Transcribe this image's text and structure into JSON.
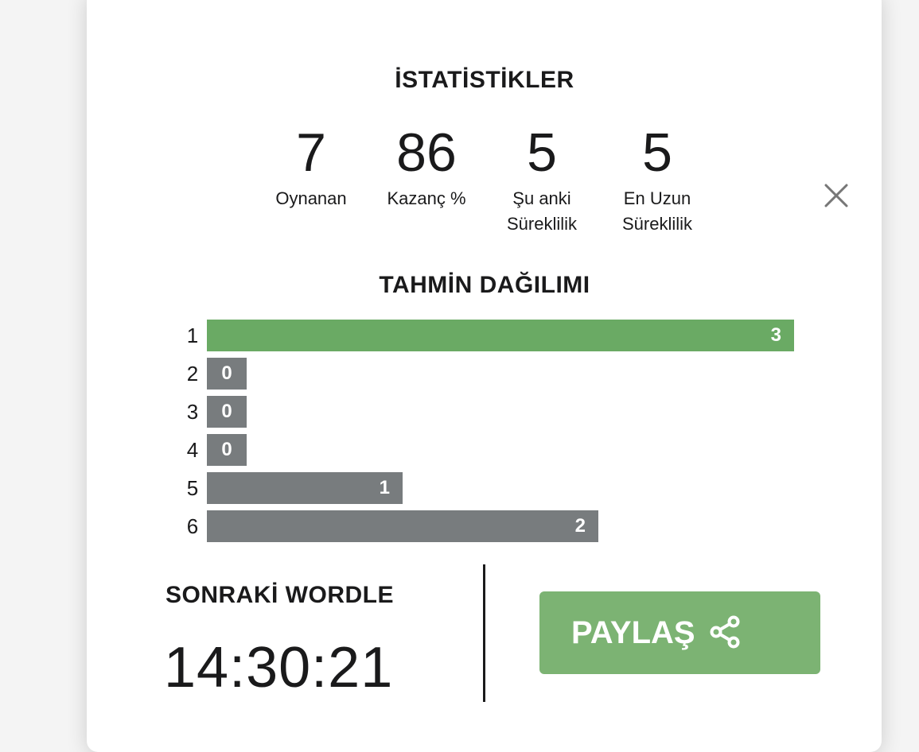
{
  "modal": {
    "close_icon": "close-icon",
    "statistics": {
      "title": "İSTATİSTİKLER",
      "played": {
        "value": "7",
        "label": "Oynanan"
      },
      "win_pct": {
        "value": "86",
        "label": "Kazanç %"
      },
      "current_streak": {
        "value": "5",
        "label_line1": "Şu anki",
        "label_line2": "Süreklilik"
      },
      "max_streak": {
        "value": "5",
        "label_line1": "En Uzun",
        "label_line2": "Süreklilik"
      }
    },
    "distribution": {
      "title": "TAHMİN DAĞILIMI",
      "rows": [
        {
          "guess": "1",
          "count": 3,
          "count_label": "3",
          "highlight": true
        },
        {
          "guess": "2",
          "count": 0,
          "count_label": "0",
          "highlight": false
        },
        {
          "guess": "3",
          "count": 0,
          "count_label": "0",
          "highlight": false
        },
        {
          "guess": "4",
          "count": 0,
          "count_label": "0",
          "highlight": false
        },
        {
          "guess": "5",
          "count": 1,
          "count_label": "1",
          "highlight": false
        },
        {
          "guess": "6",
          "count": 2,
          "count_label": "2",
          "highlight": false
        }
      ]
    },
    "footer": {
      "next_title": "SONRAKİ WORDLE",
      "countdown": "14:30:21",
      "share_label": "PAYLAŞ",
      "share_icon": "share-icon"
    }
  },
  "colors": {
    "correct": "#6aaa64",
    "absent": "#787c7e",
    "share_button": "#7cb373",
    "text": "#1a1a1b"
  }
}
